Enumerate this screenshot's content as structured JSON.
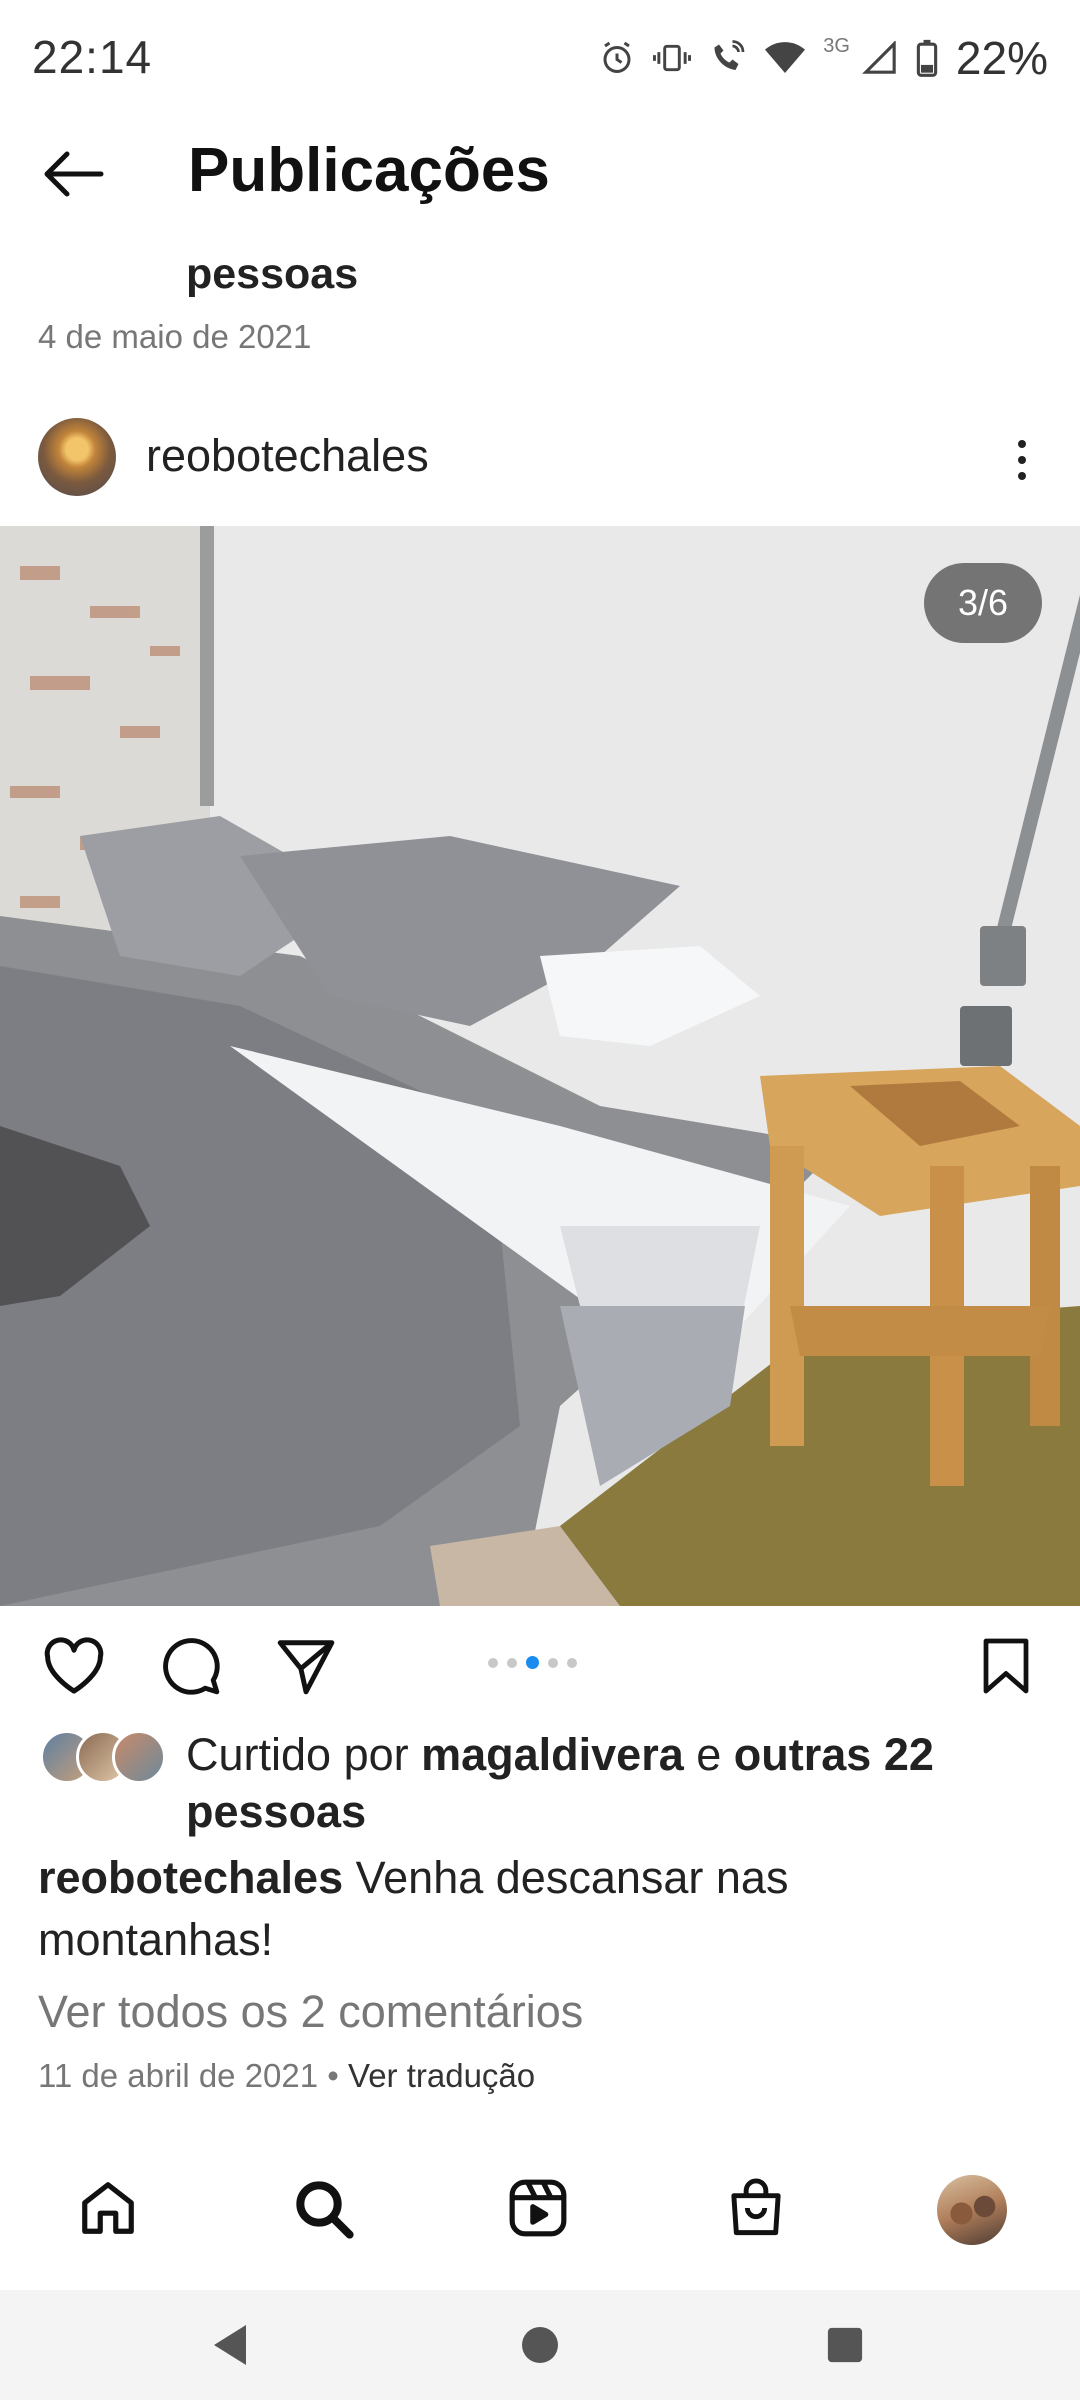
{
  "status_bar": {
    "time": "22:14",
    "network": "3G",
    "battery": "22%"
  },
  "header": {
    "title": "Publicações"
  },
  "previous_post": {
    "caption_tail": "pessoas",
    "date": "4 de maio de 2021"
  },
  "post": {
    "username": "reobotechales",
    "image_counter": "3/6",
    "carousel": {
      "total": 5,
      "active_index": 2
    },
    "likes": {
      "prefix": "Curtido por ",
      "user": "magaldivera",
      "connector": " e ",
      "others": "outras 22",
      "others_line2": "pessoas"
    },
    "caption": {
      "username": "reobotechales",
      "text_line1": " Venha descansar nas",
      "text_line2": "montanhas!"
    },
    "comments_link": "Ver todos os 2 comentários",
    "date": "11 de abril de 2021",
    "separator": " • ",
    "translate_link": "Ver tradução"
  },
  "colors": {
    "accent": "#1a8cf0",
    "text": "#222222",
    "muted": "#777777"
  },
  "icons": {
    "back": "arrow-left-icon",
    "more": "more-vertical-icon",
    "like": "heart-icon",
    "comment": "comment-icon",
    "share": "send-icon",
    "save": "bookmark-icon",
    "nav": [
      "home-icon",
      "search-icon",
      "reels-icon",
      "shop-icon",
      "profile-avatar"
    ]
  }
}
